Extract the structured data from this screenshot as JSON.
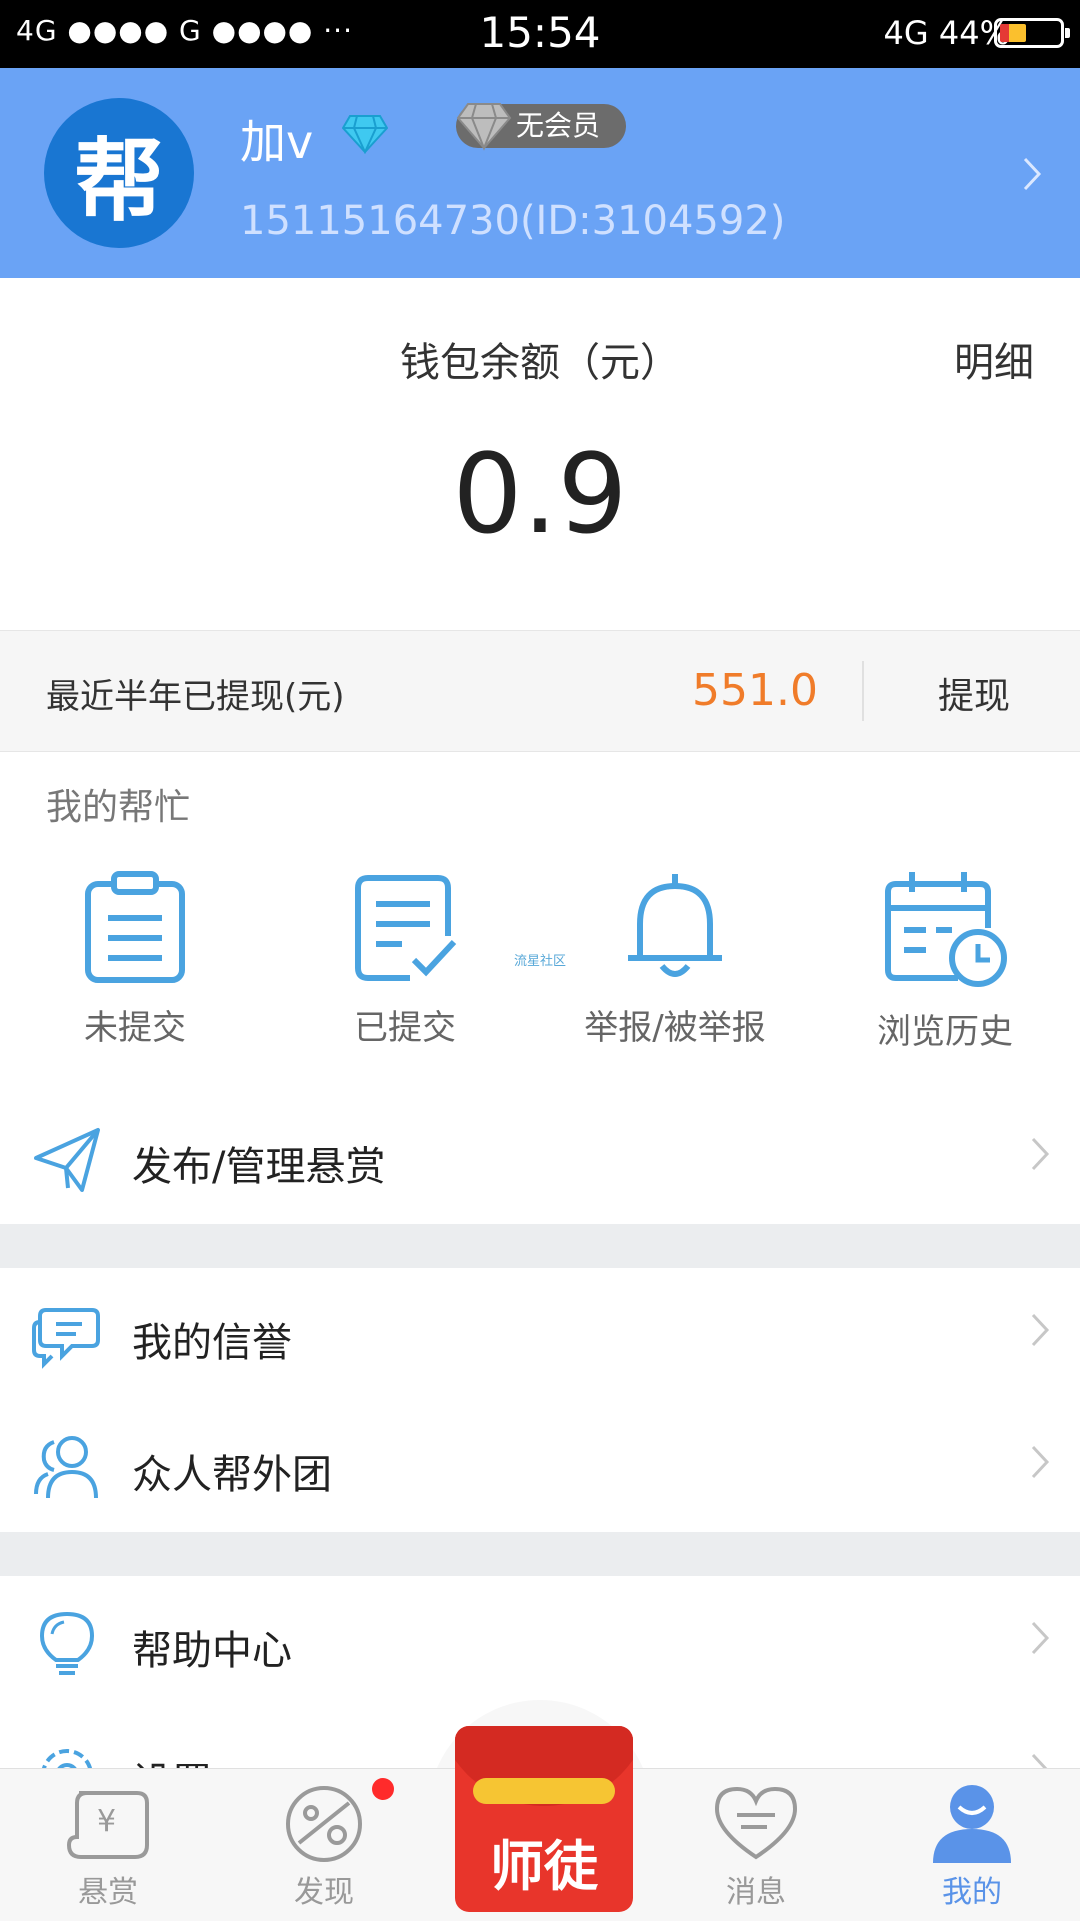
{
  "status_bar": {
    "carrier": "4G ●●●● G ●●●●  ···",
    "time": "15:54",
    "network": "4G",
    "battery": "44%"
  },
  "profile": {
    "avatar_text": "帮",
    "name": "加v",
    "membership": "无会员",
    "phone_id": "15115164730(ID:3104592)"
  },
  "wallet": {
    "title": "钱包余额（元）",
    "detail_link": "明细",
    "balance": "0.9"
  },
  "withdraw": {
    "label": "最近半年已提现(元)",
    "amount": "551.0",
    "button": "提现"
  },
  "my_help": {
    "title": "我的帮忙",
    "items": [
      {
        "label": "未提交",
        "icon": "clipboard-icon"
      },
      {
        "label": "已提交",
        "icon": "checked-document-icon"
      },
      {
        "label": "举报/被举报",
        "icon": "bell-icon"
      },
      {
        "label": "浏览历史",
        "icon": "calendar-clock-icon"
      }
    ],
    "watermark": "流星社区"
  },
  "menu": [
    {
      "label": "发布/管理悬赏",
      "icon": "paper-plane-icon"
    },
    {
      "label": "我的信誉",
      "icon": "chat-bubbles-icon"
    },
    {
      "label": "众人帮外团",
      "icon": "group-icon"
    },
    {
      "label": "帮助中心",
      "icon": "lightbulb-icon"
    },
    {
      "label": "设置",
      "icon": "gear-icon"
    }
  ],
  "tabbar": {
    "tabs": [
      {
        "label": "悬赏",
        "icon": "scroll-yen-icon"
      },
      {
        "label": "发现",
        "icon": "planet-icon"
      },
      {
        "label": "师徒",
        "icon": "red-packet-icon"
      },
      {
        "label": "消息",
        "icon": "heart-chat-icon"
      },
      {
        "label": "我的",
        "icon": "user-icon"
      }
    ],
    "active": "我的"
  },
  "colors": {
    "header_bg": "#6aa3f5",
    "accent_blue": "#4aa3e0",
    "amount_orange": "#f07c2a",
    "active_tab": "#5a93e8"
  }
}
